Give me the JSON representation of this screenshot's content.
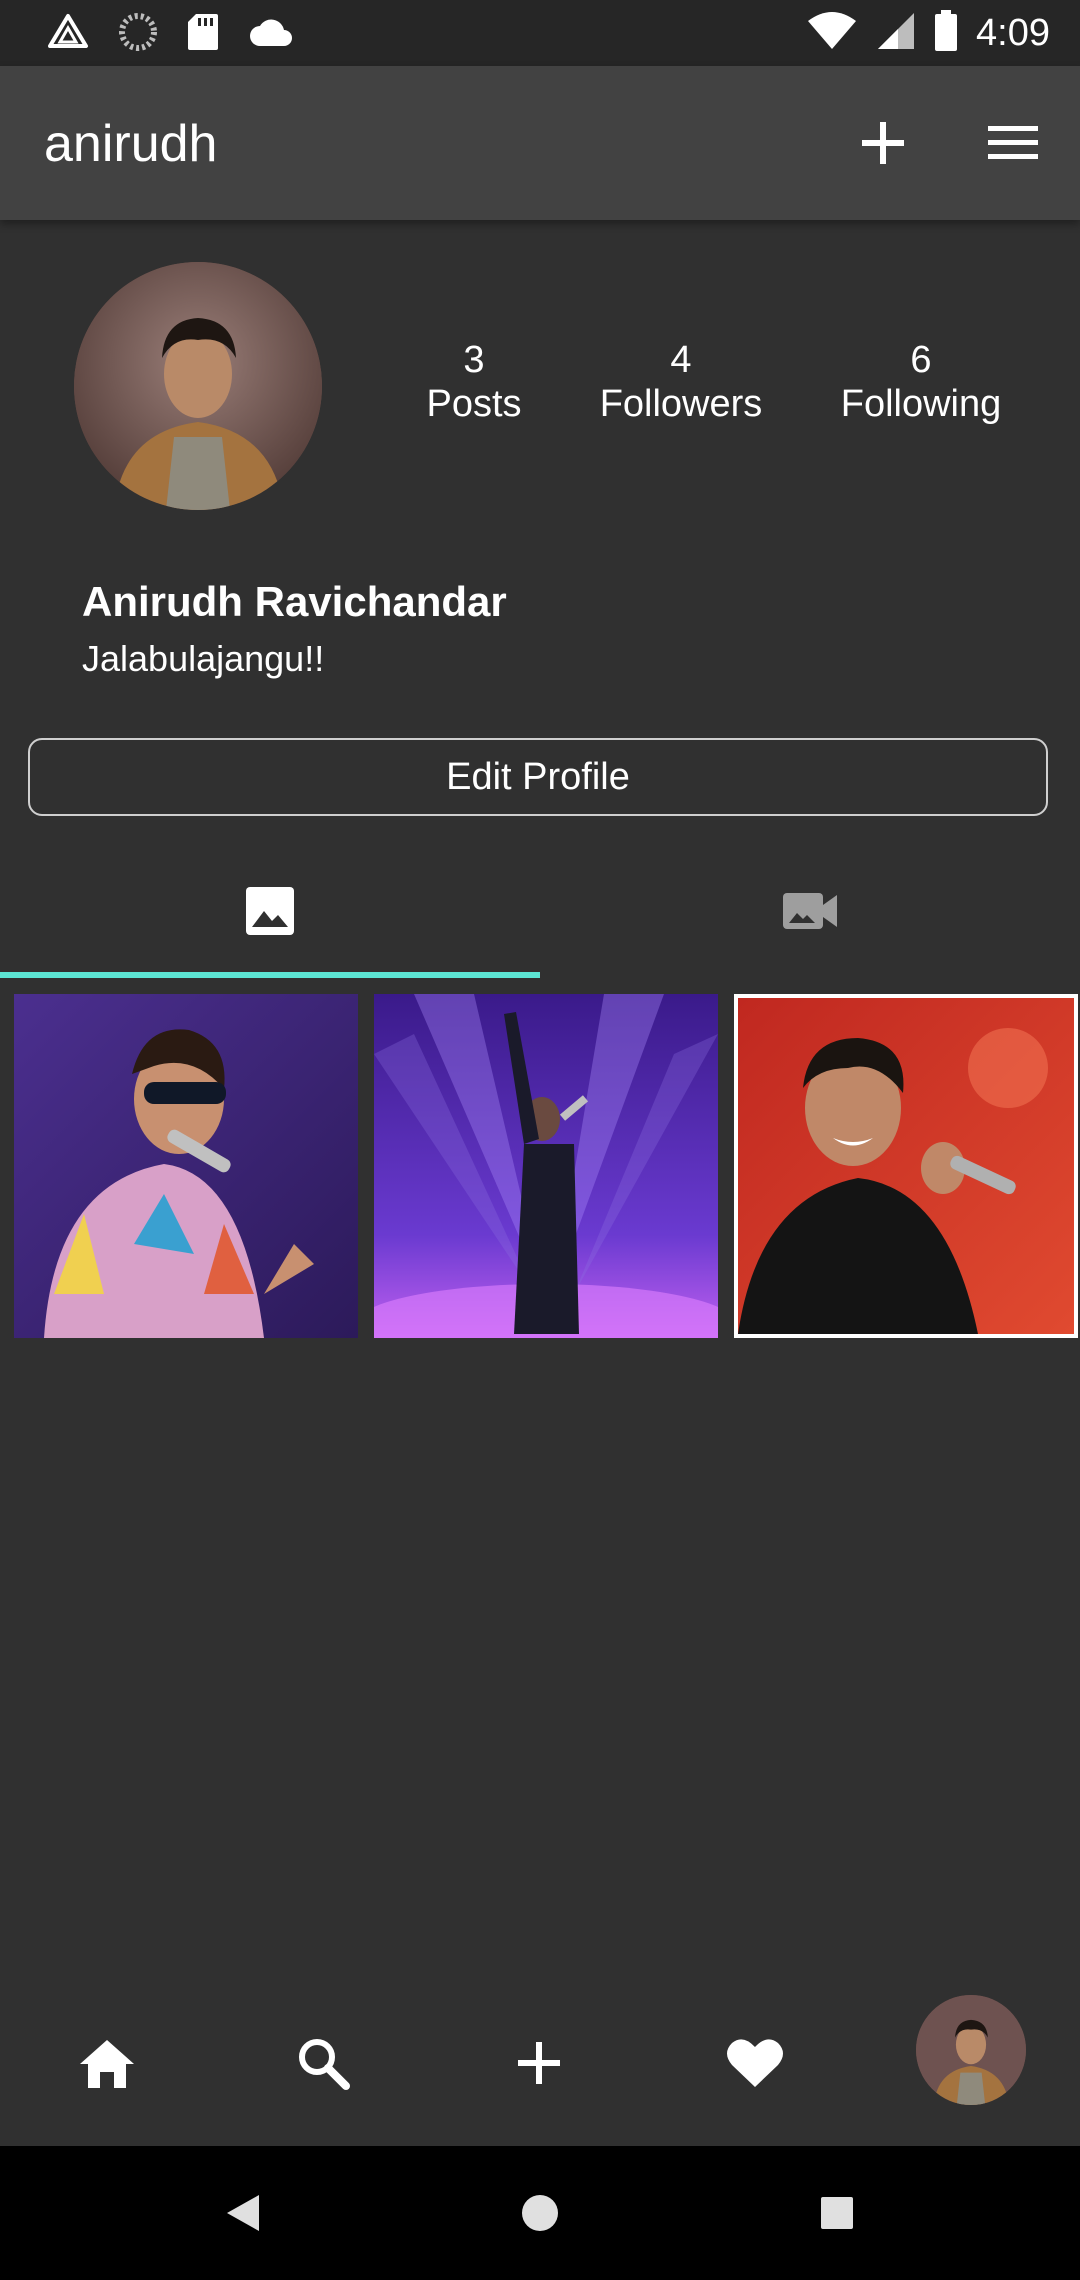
{
  "status_bar": {
    "time": "4:09",
    "left_icons": [
      "drive-icon",
      "sync-icon",
      "sd-card-icon",
      "cloud-icon"
    ],
    "right_icons": [
      "wifi-icon",
      "signal-icon",
      "battery-icon"
    ]
  },
  "app_bar": {
    "username": "anirudh",
    "actions": [
      "plus-icon",
      "menu-icon"
    ]
  },
  "profile": {
    "display_name": "Anirudh Ravichandar",
    "bio": "Jalabulajangu!!",
    "stats": [
      {
        "value": "3",
        "label": "Posts"
      },
      {
        "value": "4",
        "label": "Followers"
      },
      {
        "value": "6",
        "label": "Following"
      }
    ],
    "edit_button_label": "Edit Profile"
  },
  "tabs": {
    "items": [
      {
        "icon": "image-icon",
        "selected": true
      },
      {
        "icon": "video-camera-icon",
        "selected": false
      }
    ],
    "indicator_color": "#5ce6d4"
  },
  "grid": {
    "posts": [
      {
        "description": "performer-with-sunglasses"
      },
      {
        "description": "performer-on-purple-stage"
      },
      {
        "description": "performer-singing-red-background"
      }
    ]
  },
  "bottom_nav": {
    "items": [
      "home-icon",
      "search-icon",
      "add-icon",
      "heart-icon",
      "profile-avatar"
    ]
  },
  "system_nav": {
    "items": [
      "back-icon",
      "home-circle-icon",
      "recents-icon"
    ]
  },
  "colors": {
    "background": "#303030",
    "app_bar": "#424242",
    "accent": "#5ce6d4",
    "text": "#ffffff"
  }
}
